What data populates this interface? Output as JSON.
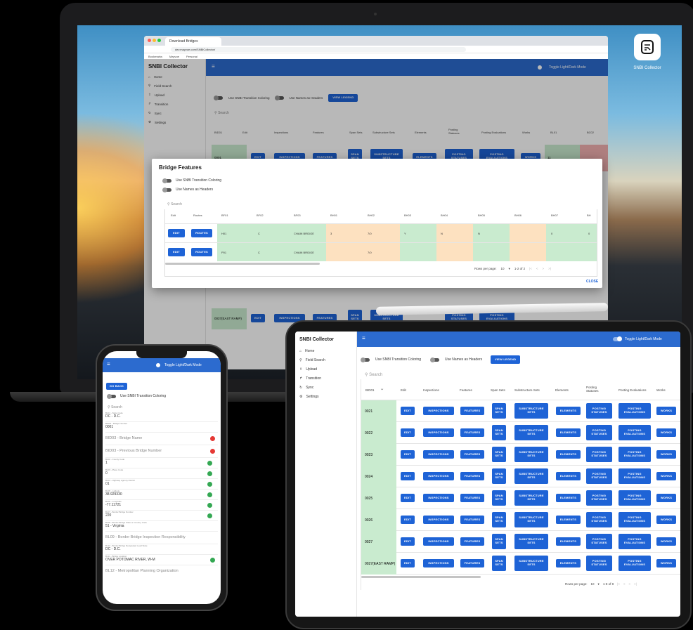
{
  "laptop": {
    "brand_label": "SNBI Collector",
    "browser": {
      "tab_title": "Download Bridges",
      "url": "dev.mayvue.com/SNBICollector/",
      "bookmarks": [
        "Bookmarks",
        "Mayvue",
        "Personal"
      ]
    },
    "app": {
      "title": "SNBI Collector",
      "toggle_label": "Toggle Light/Dark Mode",
      "sidebar": [
        "Home",
        "Field Search",
        "Upload",
        "Transition",
        "Sync",
        "Settings"
      ],
      "options": {
        "coloring": "Use SNBI Transition Coloring",
        "names": "Use Names as Headers",
        "legend": "VIEW LEGEND"
      },
      "search": "Search",
      "headers": [
        "BID01",
        "Edit",
        "Inspections",
        "Features",
        "Span Sets",
        "Substructure Sets",
        "Elements",
        "Posting Statuses",
        "Posting Evaluations",
        "Works",
        "BL01",
        "BC02"
      ],
      "row1": {
        "id": "0001",
        "value": "11"
      },
      "row_last": {
        "id": "0037(EAST RAMP)"
      }
    },
    "modal": {
      "title": "Bridge Features",
      "coloring": "Use SNBI Transition Coloring",
      "names": "Use Names as Headers",
      "search": "Search",
      "headers": [
        "Edit",
        "Routes",
        "BF01",
        "BF02",
        "BF03",
        "BH01",
        "BH02",
        "BH03",
        "BH04",
        "BH05",
        "BH06",
        "BH07",
        "BH"
      ],
      "rows": [
        {
          "edit": "EDIT",
          "routes": "ROUTES",
          "bf01": "H01",
          "bf02": "C",
          "bf03": "CHAIN BRIDGE",
          "bh01": "3",
          "bh02": "7/0",
          "bh03": "Y",
          "bh04": "N",
          "bh05": "N",
          "bh06": "",
          "bh07": "0",
          "bh08": "0"
        },
        {
          "edit": "EDIT",
          "routes": "ROUTES",
          "bf01": "P01",
          "bf02": "C",
          "bf03": "CHAIN BRIDGE",
          "bh01": "",
          "bh02": "7/0",
          "bh03": "",
          "bh04": "",
          "bh05": "",
          "bh06": "",
          "bh07": "",
          "bh08": ""
        }
      ],
      "pagination": {
        "rows_per_page": "Rows per page:",
        "count": "10",
        "range": "1-2 of 2"
      },
      "close": "CLOSE"
    }
  },
  "phone": {
    "toggle_label": "Toggle Light/Dark Mode",
    "go_back": "GO BACK",
    "coloring": "Use SNBI Transition Coloring",
    "search": "Search",
    "fields": [
      {
        "label": "BL01 - State Code",
        "value": "DC - D.C."
      },
      {
        "label": "BID01 - Bridge Number",
        "value": "0001"
      },
      {
        "label": "",
        "value": "BID03 - Bridge Name"
      },
      {
        "label": "",
        "value": "BID03 - Previous Bridge Number"
      },
      {
        "label": "BL02 - County Code",
        "value": "1"
      },
      {
        "label": "BL03 - Place Code",
        "value": "0"
      },
      {
        "label": "BL04 - Highway Agency District",
        "value": "01"
      },
      {
        "label": "BL05 - Latitude",
        "value": "38.929330"
      },
      {
        "label": "BL06 - Longitude",
        "value": "-77.11721"
      },
      {
        "label": "BL07 - Border Bridge Number",
        "value": "220"
      },
      {
        "label": "BL08 - Border Bridge State or Country Code",
        "value": "51 - Virginia"
      },
      {
        "label": "",
        "value": "BL09 - Border Bridge Inspection Responsibility"
      },
      {
        "label": "BL10 - Border Bridge Designated Lead State",
        "value": "DC - D.C."
      },
      {
        "label": "BL11 - Bridge Location",
        "value": "OVER POTOMAC RIVER, W-M"
      },
      {
        "label": "",
        "value": "BL12 - Metropolitan Planning Organization"
      }
    ]
  },
  "tablet": {
    "title": "SNBI Collector",
    "toggle_label": "Toggle Light/Dark Mode",
    "sidebar": [
      "Home",
      "Field Search",
      "Upload",
      "Transition",
      "Sync",
      "Settings"
    ],
    "options": {
      "coloring": "Use SNBI Transition Coloring",
      "names": "Use Names as Headers",
      "legend": "VIEW LEGEND"
    },
    "search": "Search",
    "headers": [
      "BID01",
      "Edit",
      "Inspections",
      "Features",
      "Span Sets",
      "Substructure Sets",
      "Elements",
      "Posting Statuses",
      "Posting Evaluations",
      "Works"
    ],
    "buttons": {
      "edit": "EDIT",
      "inspections": "INSPECTIONS",
      "features": "FEATURES",
      "span": "SPAN SETS",
      "sub": "SUBSTRUCTURE SETS",
      "elements": "ELEMENTS",
      "statuses": "POSTING STATUSES",
      "evaluations": "POSTING EVALUATIONS",
      "works": "WORKS"
    },
    "rows": [
      "0021",
      "0022",
      "0023",
      "0024",
      "0025",
      "0026",
      "0027",
      "0027(EAST RAMP)"
    ],
    "pagination": {
      "rows_per_page": "Rows per page:",
      "count": "10",
      "range": "1-8 of 8"
    }
  },
  "colors": {
    "accent": "#1e63d6",
    "cell_green": "#c9ebcf",
    "cell_orange": "#fde1c0",
    "cell_red": "#f3b0b0"
  }
}
